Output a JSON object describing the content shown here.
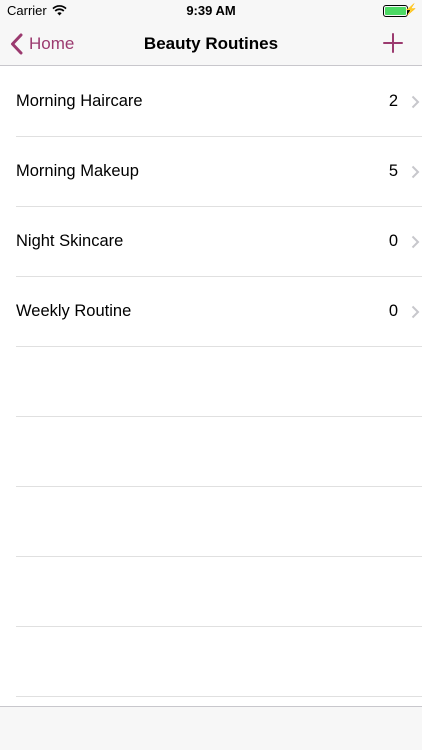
{
  "status_bar": {
    "carrier": "Carrier",
    "time": "9:39 AM",
    "icons": [
      "wifi-icon",
      "battery-icon",
      "charging-bolt-icon"
    ],
    "battery_color": "#4cd964"
  },
  "nav": {
    "back_label": "Home",
    "title": "Beauty Routines",
    "accent_color": "#9b3a6f",
    "icons": [
      "chevron-left-icon",
      "plus-icon"
    ]
  },
  "routines": [
    {
      "title": "Morning Haircare",
      "count": "2"
    },
    {
      "title": "Morning Makeup",
      "count": "5"
    },
    {
      "title": "Night Skincare",
      "count": "0"
    },
    {
      "title": "Weekly Routine",
      "count": "0"
    }
  ]
}
